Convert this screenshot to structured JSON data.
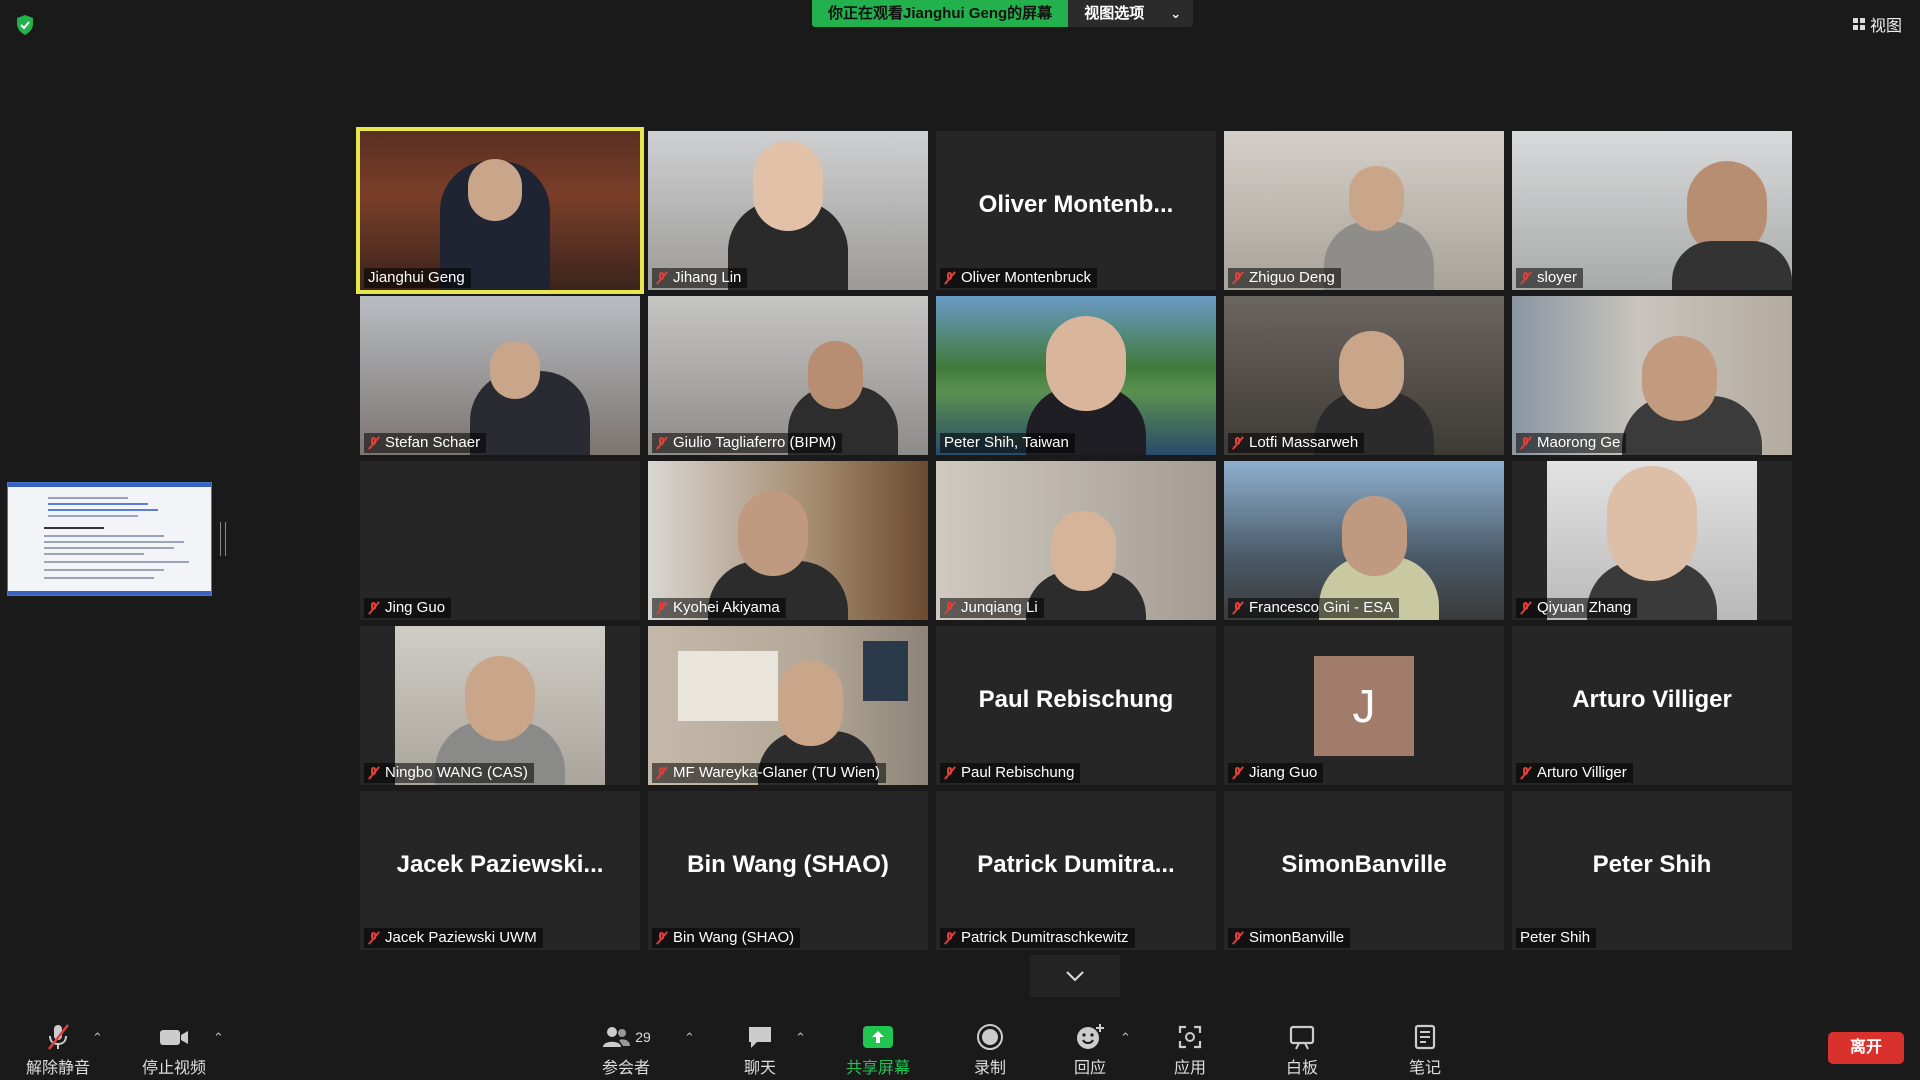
{
  "topbar": {
    "share_banner": "你正在观看Jianghui  Geng的屏幕",
    "view_options": "视图选项",
    "view_button": "视图"
  },
  "participants": [
    {
      "label": "Jianghui Geng",
      "muted": false,
      "video": true
    },
    {
      "label": "Jihang Lin",
      "muted": true,
      "video": true
    },
    {
      "label": "Oliver Montenbruck",
      "display_name": "Oliver  Montenb...",
      "muted": true,
      "video": false
    },
    {
      "label": "Zhiguo Deng",
      "muted": true,
      "video": true
    },
    {
      "label": "sloyer",
      "muted": true,
      "video": true
    },
    {
      "label": "Stefan Schaer",
      "muted": true,
      "video": true
    },
    {
      "label": "Giulio Tagliaferro (BIPM)",
      "muted": true,
      "video": true
    },
    {
      "label": "Peter Shih, Taiwan",
      "muted": false,
      "video": true
    },
    {
      "label": "Lotfi Massarweh",
      "muted": true,
      "video": true
    },
    {
      "label": "Maorong Ge",
      "muted": true,
      "video": true
    },
    {
      "label": "Jing Guo",
      "muted": true,
      "video": false
    },
    {
      "label": "Kyohei Akiyama",
      "muted": true,
      "video": true
    },
    {
      "label": "Junqiang Li",
      "muted": true,
      "video": true
    },
    {
      "label": "Francesco Gini - ESA",
      "muted": true,
      "video": true
    },
    {
      "label": "Qiyuan Zhang",
      "muted": true,
      "video": true
    },
    {
      "label": "Ningbo WANG (CAS)",
      "muted": true,
      "video": true
    },
    {
      "label": "MF Wareyka-Glaner (TU Wien)",
      "muted": true,
      "video": true
    },
    {
      "label": "Paul Rebischung",
      "display_name": "Paul Rebischung",
      "muted": true,
      "video": false
    },
    {
      "label": "Jiang Guo",
      "avatar_letter": "J",
      "muted": true,
      "video": false
    },
    {
      "label": "Arturo Villiger",
      "display_name": "Arturo Villiger",
      "muted": true,
      "video": false
    },
    {
      "label": "Jacek Paziewski UWM",
      "display_name": "Jacek  Paziewski...",
      "muted": true,
      "video": false
    },
    {
      "label": "Bin Wang (SHAO)",
      "display_name": "Bin Wang (SHAO)",
      "muted": true,
      "video": false
    },
    {
      "label": "Patrick Dumitraschkewitz",
      "display_name": "Patrick  Dumitra...",
      "muted": true,
      "video": false
    },
    {
      "label": "SimonBanville",
      "display_name": "SimonBanville",
      "muted": true,
      "video": false
    },
    {
      "label": "Peter Shih",
      "display_name": "Peter Shih",
      "muted": false,
      "video": false
    }
  ],
  "toolbar": {
    "unmute": "解除静音",
    "stop_video": "停止视频",
    "participants": "参会者",
    "participants_count": "29",
    "chat": "聊天",
    "share_screen": "共享屏幕",
    "record": "录制",
    "reactions": "回应",
    "apps": "应用",
    "whiteboard": "白板",
    "notes": "笔记",
    "leave": "离开"
  },
  "colors": {
    "background": "#1a1a1a",
    "tile": "#262626",
    "accent_green": "#23b14d",
    "active_border": "#e8e64e",
    "leave_red": "#d9322c",
    "mute_red": "#e0403c"
  }
}
